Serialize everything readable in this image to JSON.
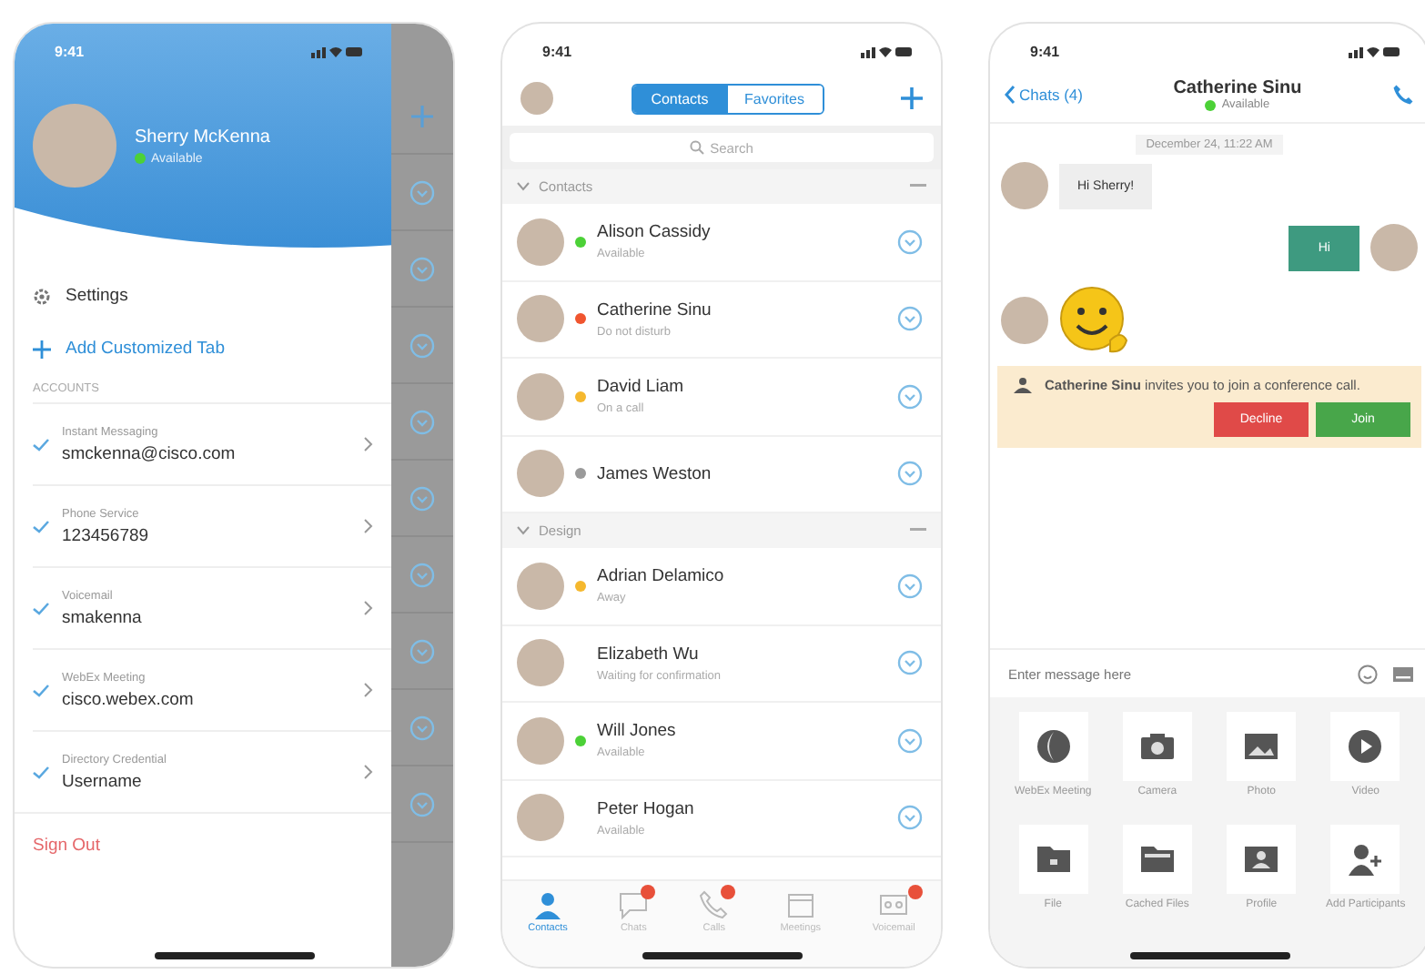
{
  "settings_screen": {
    "status_time": "9:41",
    "profile": {
      "name": "Sherry McKenna",
      "status": "Available",
      "color": "#4cd137"
    },
    "menu": [
      {
        "kind": "settings",
        "label": "Settings"
      },
      {
        "kind": "add",
        "label": "Add Customized Tab"
      }
    ],
    "accounts_header": "ACCOUNTS",
    "accounts": [
      {
        "type": "Instant Messaging",
        "value": "smckenna@cisco.com",
        "checked": true
      },
      {
        "type": "Phone Service",
        "value": "123456789",
        "checked": true
      },
      {
        "type": "Voicemail",
        "value": "smakenna",
        "checked": true
      },
      {
        "type": "WebEx Meeting",
        "value": "cisco.webex.com",
        "checked": true
      },
      {
        "type": "Directory Credential",
        "value": "Username",
        "checked": true
      }
    ],
    "sign_out": "Sign Out"
  },
  "contacts_screen": {
    "status_time": "9:41",
    "tabs": [
      {
        "label": "Contacts",
        "selected": true
      },
      {
        "label": "Favorites",
        "selected": false
      }
    ],
    "search": {
      "placeholder": "Search"
    },
    "groups": [
      {
        "name": "Contacts",
        "expanded": true,
        "contacts": [
          {
            "name": "Alison Cassidy",
            "status": "Available",
            "color": "#4cd137"
          },
          {
            "name": "Catherine Sinu",
            "status": "Do not disturb",
            "color": "#f0552f"
          },
          {
            "name": "David Liam",
            "status": "On a call",
            "color": "#f5b82e"
          },
          {
            "name": "James Weston",
            "color": "#9a9a9a"
          }
        ]
      },
      {
        "name": "Design",
        "expanded": true,
        "contacts": [
          {
            "name": "Adrian Delamico",
            "status": "Away",
            "color": "#f5b82e"
          },
          {
            "name": "Elizabeth Wu",
            "status": "Waiting for confirmation"
          },
          {
            "name": "Will Jones",
            "status": "Available",
            "color": "#4cd137"
          },
          {
            "name": "Peter Hogan",
            "status": "Available"
          }
        ]
      }
    ],
    "bottom_tabs": [
      {
        "kind": "contacts",
        "label": "Contacts",
        "selected": true,
        "badge": false
      },
      {
        "kind": "chats",
        "label": "Chats",
        "selected": false,
        "badge": true
      },
      {
        "kind": "calls",
        "label": "Calls",
        "selected": false,
        "badge": true
      },
      {
        "kind": "meetings",
        "label": "Meetings",
        "selected": false,
        "badge": false
      },
      {
        "kind": "voicemail",
        "label": "Voicemail",
        "selected": false,
        "badge": true
      }
    ]
  },
  "chat_screen": {
    "status_time": "9:41",
    "back_label": "Chats (4)",
    "title": "Catherine Sinu",
    "status": "Available",
    "color": "#4cd137",
    "timestamp": "December 24, 11:22 AM",
    "messages": [
      {
        "kind": "incoming",
        "text": "Hi Sherry!"
      },
      {
        "kind": "outgoing",
        "text": "Hi"
      },
      {
        "kind": "emoji"
      }
    ],
    "invite": {
      "sender": "Catherine Sinu",
      "text": "invites you to join a conference call.",
      "decline": "Decline",
      "join": "Join"
    },
    "input": {
      "placeholder": "Enter message here"
    },
    "actions": [
      {
        "kind": "meeting",
        "label": "WebEx Meeting"
      },
      {
        "kind": "camera",
        "label": "Camera"
      },
      {
        "kind": "photo",
        "label": "Photo"
      },
      {
        "kind": "video",
        "label": "Video"
      },
      {
        "kind": "file",
        "label": "File"
      },
      {
        "kind": "cached",
        "label": "Cached Files"
      },
      {
        "kind": "profile",
        "label": "Profile"
      },
      {
        "kind": "add-person",
        "label": "Add Participants"
      }
    ]
  }
}
